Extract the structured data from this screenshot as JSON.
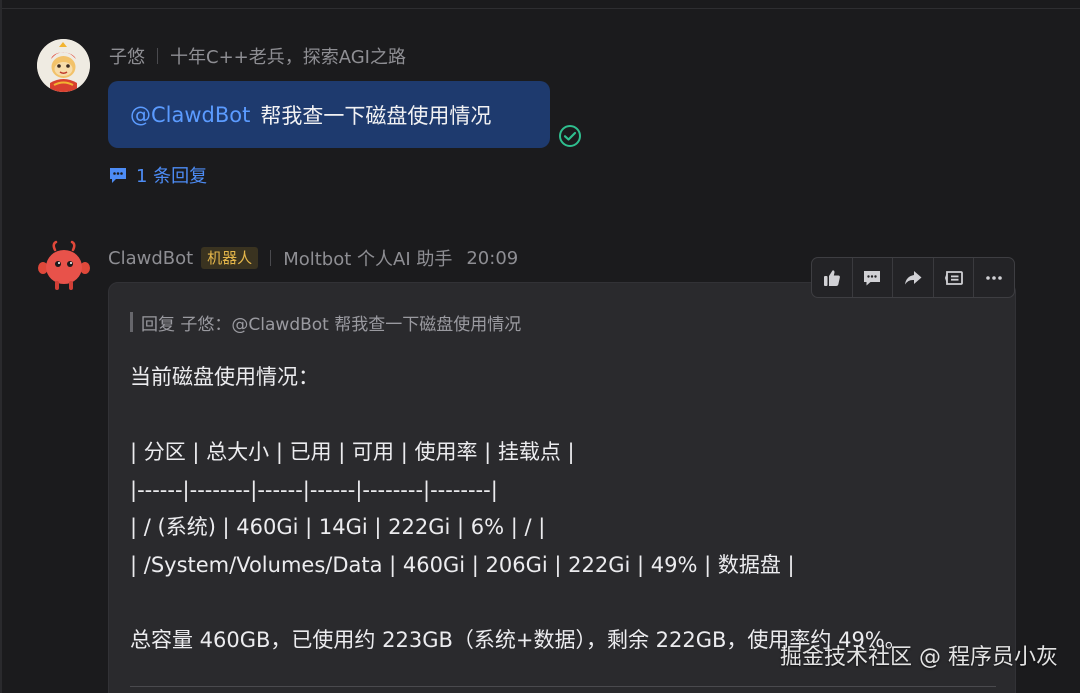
{
  "message1": {
    "author": "子悠",
    "signature": "十年C++老兵，探索AGI之路",
    "mention": "@ClawdBot",
    "text": "帮我查一下磁盘使用情况",
    "replies_label": "1 条回复",
    "avatar_icon": "lion-dance-avatar",
    "read_icon": "check-circle-icon"
  },
  "message2": {
    "author": "ClawdBot",
    "badge": "机器人",
    "description": "Moltbot 个人AI 助手",
    "time": "20:09",
    "avatar_icon": "red-crab-bot-avatar",
    "quote": "回复 子悠：@ClawdBot 帮我查一下磁盘使用情况",
    "lines": [
      "当前磁盘使用情况：",
      "",
      "| 分区 | 总大小 | 已用 | 可用 | 使用率 | 挂载点 |",
      "|------|--------|------|------|--------|--------|",
      "| / (系统) | 460Gi | 14Gi | 222Gi | 6% | / |",
      "| /System/Volumes/Data | 460Gi | 206Gi | 222Gi | 49% | 数据盘 |",
      "",
      "总容量 460GB，已使用约 223GB（系统+数据），剩余 222GB，使用率约 49%。"
    ]
  },
  "toolbar": {
    "icons": [
      "thumbs-up-icon",
      "comment-icon",
      "forward-icon",
      "quote-reply-icon",
      "more-icon"
    ]
  },
  "watermark": "掘金技术社区 @ 程序员小灰",
  "colors": {
    "background": "#1b1b1d",
    "bubble": "#1e3a6e",
    "mention": "#5b9bff",
    "link": "#4d8cf5",
    "read_check": "#2fbf8f",
    "badge_text": "#e4b64a",
    "card": "#2a2a2d"
  }
}
